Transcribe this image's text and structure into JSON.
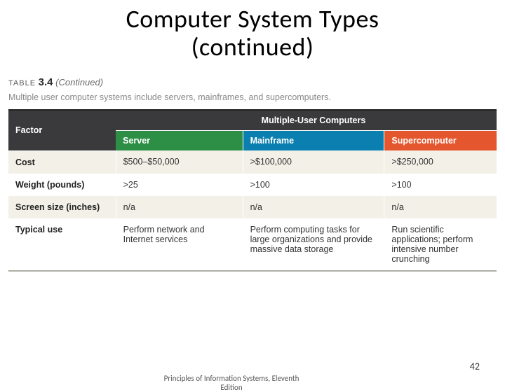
{
  "title_line1": "Computer System Types",
  "title_line2": "(continued)",
  "table_label": {
    "word": "TABLE",
    "number": "3.4",
    "cont": "(Continued)"
  },
  "caption": "Multiple user computer systems include servers, mainframes, and supercomputers.",
  "header": {
    "factor": "Factor",
    "group": "Multiple-User Computers",
    "cols": [
      "Server",
      "Mainframe",
      "Supercomputer"
    ]
  },
  "rows": [
    {
      "factor": "Cost",
      "cells": [
        "$500–$50,000",
        ">$100,000",
        ">$250,000"
      ]
    },
    {
      "factor": "Weight (pounds)",
      "cells": [
        ">25",
        ">100",
        ">100"
      ]
    },
    {
      "factor": "Screen size (inches)",
      "cells": [
        "n/a",
        "n/a",
        "n/a"
      ]
    },
    {
      "factor": "Typical use",
      "cells": [
        "Perform network and Internet services",
        "Perform computing tasks for large organizations and provide massive data storage",
        "Run scientific applications; perform intensive number crunching"
      ]
    }
  ],
  "footer": {
    "source_l1": "Principles of Information Systems, Eleventh",
    "source_l2": "Edition",
    "page": "42"
  },
  "chart_data": {
    "type": "table",
    "title": "TABLE 3.4 (Continued) — Multiple-User Computers",
    "columns": [
      "Factor",
      "Server",
      "Mainframe",
      "Supercomputer"
    ],
    "rows": [
      [
        "Cost",
        "$500–$50,000",
        ">$100,000",
        ">$250,000"
      ],
      [
        "Weight (pounds)",
        ">25",
        ">100",
        ">100"
      ],
      [
        "Screen size (inches)",
        "n/a",
        "n/a",
        "n/a"
      ],
      [
        "Typical use",
        "Perform network and Internet services",
        "Perform computing tasks for large organizations and provide massive data storage",
        "Run scientific applications; perform intensive number crunching"
      ]
    ]
  }
}
